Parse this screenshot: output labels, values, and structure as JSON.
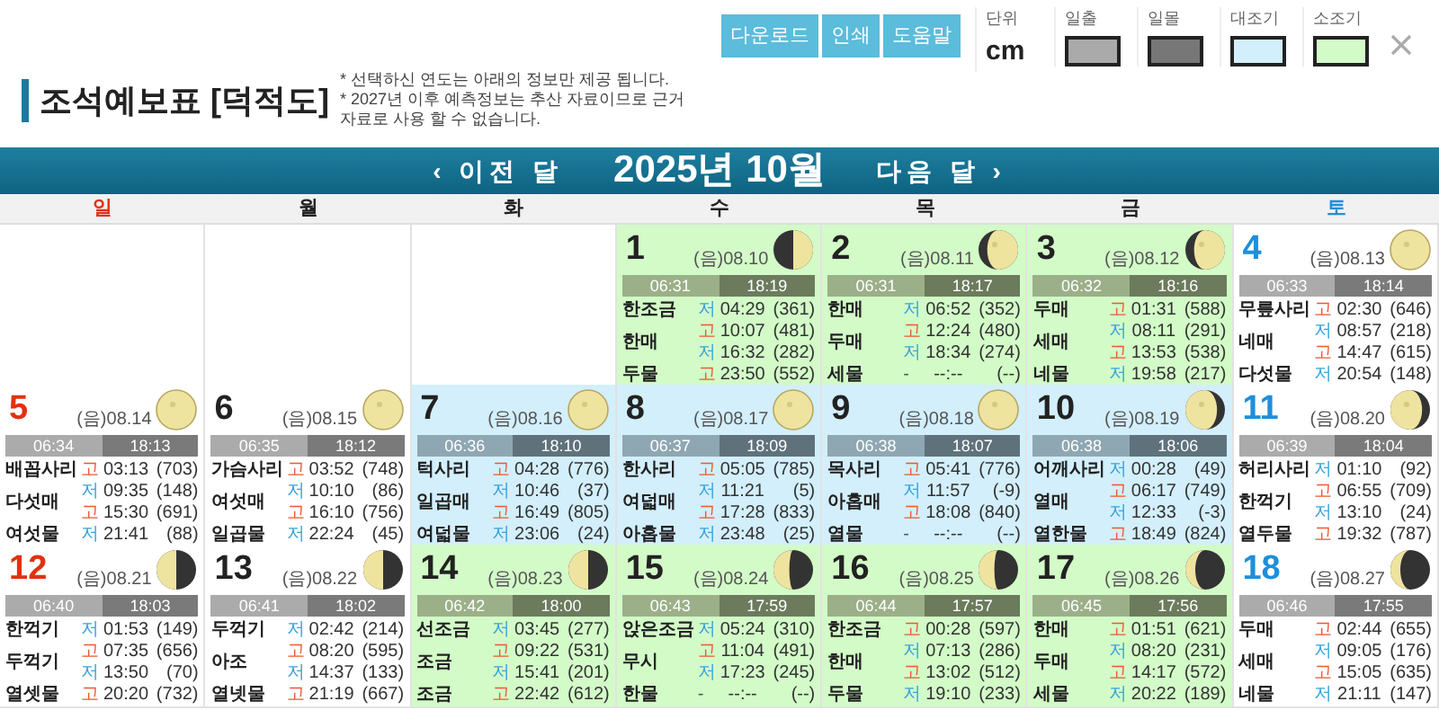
{
  "toolbar": {
    "buttons": [
      "다운로드",
      "인쇄",
      "도움말"
    ],
    "unit": {
      "label": "단위",
      "value": "cm"
    },
    "legend": [
      {
        "label": "일출",
        "color": "#aaaaaa"
      },
      {
        "label": "일몰",
        "color": "#777777"
      },
      {
        "label": "대조기",
        "color": "#d3effc"
      },
      {
        "label": "소조기",
        "color": "#d3fbc8"
      }
    ]
  },
  "title": "조석예보표 [덕적도]",
  "notes": [
    "* 선택하신 연도는 아래의 정보만 제공 됩니다.",
    "* 2027년 이후 예측정보는 추산 자료이므로 근거 자료로 사용 할 수 없습니다."
  ],
  "nav": {
    "prev": "‹ 이전 달",
    "month": "2025년 10월",
    "next": "다음 달 ›"
  },
  "weekdays": [
    {
      "label": "일",
      "kind": "sunday"
    },
    {
      "label": "월",
      "kind": "weekday"
    },
    {
      "label": "화",
      "kind": "weekday"
    },
    {
      "label": "수",
      "kind": "weekday"
    },
    {
      "label": "목",
      "kind": "weekday"
    },
    {
      "label": "금",
      "kind": "weekday"
    },
    {
      "label": "토",
      "kind": "saturday"
    }
  ],
  "weeks": [
    [
      {
        "kind": "empty"
      },
      {
        "kind": "empty"
      },
      {
        "kind": "empty"
      },
      {
        "kind": "neap",
        "day": "1",
        "lunar": "(음)08.10",
        "moon": {
          "kind": "first-quarter"
        },
        "sunrise": "06:31",
        "sunset": "18:19",
        "names": [
          "한조금",
          "한매",
          "두물"
        ],
        "tides": [
          {
            "kind": "low",
            "mark": "저",
            "time": "04:29",
            "height": "(361)"
          },
          {
            "kind": "high",
            "mark": "고",
            "time": "10:07",
            "height": "(481)"
          },
          {
            "kind": "low",
            "mark": "저",
            "time": "16:32",
            "height": "(282)"
          },
          {
            "kind": "high",
            "mark": "고",
            "time": "23:50",
            "height": "(552)"
          }
        ]
      },
      {
        "kind": "neap",
        "day": "2",
        "lunar": "(음)08.11",
        "moon": {
          "kind": "waxing-gibbous"
        },
        "sunrise": "06:31",
        "sunset": "18:17",
        "names": [
          "한매",
          "두매",
          "세물"
        ],
        "tides": [
          {
            "kind": "low",
            "mark": "저",
            "time": "06:52",
            "height": "(352)"
          },
          {
            "kind": "high",
            "mark": "고",
            "time": "12:24",
            "height": "(480)"
          },
          {
            "kind": "low",
            "mark": "저",
            "time": "18:34",
            "height": "(274)"
          },
          {
            "kind": "none",
            "mark": "-",
            "time": "--:--",
            "height": "(--)"
          }
        ]
      },
      {
        "kind": "neap",
        "day": "3",
        "lunar": "(음)08.12",
        "moon": {
          "kind": "waxing-gibbous"
        },
        "sunrise": "06:32",
        "sunset": "18:16",
        "names": [
          "두매",
          "세매",
          "네물"
        ],
        "tides": [
          {
            "kind": "high",
            "mark": "고",
            "time": "01:31",
            "height": "(588)"
          },
          {
            "kind": "low",
            "mark": "저",
            "time": "08:11",
            "height": "(291)"
          },
          {
            "kind": "high",
            "mark": "고",
            "time": "13:53",
            "height": "(538)"
          },
          {
            "kind": "low",
            "mark": "저",
            "time": "19:58",
            "height": "(217)"
          }
        ]
      },
      {
        "kind": "normal",
        "day": "4",
        "lunar": "(음)08.13",
        "moon": {
          "kind": "full"
        },
        "sunrise": "06:33",
        "sunset": "18:14",
        "names": [
          "무릎사리",
          "네매",
          "다섯물"
        ],
        "tides": [
          {
            "kind": "high",
            "mark": "고",
            "time": "02:30",
            "height": "(646)"
          },
          {
            "kind": "low",
            "mark": "저",
            "time": "08:57",
            "height": "(218)"
          },
          {
            "kind": "high",
            "mark": "고",
            "time": "14:47",
            "height": "(615)"
          },
          {
            "kind": "low",
            "mark": "저",
            "time": "20:54",
            "height": "(148)"
          }
        ]
      }
    ],
    [
      {
        "kind": "normal",
        "day": "5",
        "lunar": "(음)08.14",
        "moon": {
          "kind": "full"
        },
        "sunrise": "06:34",
        "sunset": "18:13",
        "names": [
          "배꼽사리",
          "다섯매",
          "여섯물"
        ],
        "tides": [
          {
            "kind": "high",
            "mark": "고",
            "time": "03:13",
            "height": "(703)"
          },
          {
            "kind": "low",
            "mark": "저",
            "time": "09:35",
            "height": "(148)"
          },
          {
            "kind": "high",
            "mark": "고",
            "time": "15:30",
            "height": "(691)"
          },
          {
            "kind": "low",
            "mark": "저",
            "time": "21:41",
            "height": "(88)"
          }
        ]
      },
      {
        "kind": "normal",
        "day": "6",
        "lunar": "(음)08.15",
        "moon": {
          "kind": "full"
        },
        "sunrise": "06:35",
        "sunset": "18:12",
        "names": [
          "가슴사리",
          "여섯매",
          "일곱물"
        ],
        "tides": [
          {
            "kind": "high",
            "mark": "고",
            "time": "03:52",
            "height": "(748)"
          },
          {
            "kind": "low",
            "mark": "저",
            "time": "10:10",
            "height": "(86)"
          },
          {
            "kind": "high",
            "mark": "고",
            "time": "16:10",
            "height": "(756)"
          },
          {
            "kind": "low",
            "mark": "저",
            "time": "22:24",
            "height": "(45)"
          }
        ]
      },
      {
        "kind": "spring",
        "day": "7",
        "lunar": "(음)08.16",
        "moon": {
          "kind": "full"
        },
        "sunrise": "06:36",
        "sunset": "18:10",
        "names": [
          "턱사리",
          "일곱매",
          "여덟물"
        ],
        "tides": [
          {
            "kind": "high",
            "mark": "고",
            "time": "04:28",
            "height": "(776)"
          },
          {
            "kind": "low",
            "mark": "저",
            "time": "10:46",
            "height": "(37)"
          },
          {
            "kind": "high",
            "mark": "고",
            "time": "16:49",
            "height": "(805)"
          },
          {
            "kind": "low",
            "mark": "저",
            "time": "23:06",
            "height": "(24)"
          }
        ]
      },
      {
        "kind": "spring",
        "day": "8",
        "lunar": "(음)08.17",
        "moon": {
          "kind": "full"
        },
        "sunrise": "06:37",
        "sunset": "18:09",
        "names": [
          "한사리",
          "여덟매",
          "아홉물"
        ],
        "tides": [
          {
            "kind": "high",
            "mark": "고",
            "time": "05:05",
            "height": "(785)"
          },
          {
            "kind": "low",
            "mark": "저",
            "time": "11:21",
            "height": "(5)"
          },
          {
            "kind": "high",
            "mark": "고",
            "time": "17:28",
            "height": "(833)"
          },
          {
            "kind": "low",
            "mark": "저",
            "time": "23:48",
            "height": "(25)"
          }
        ]
      },
      {
        "kind": "spring",
        "day": "9",
        "lunar": "(음)08.18",
        "moon": {
          "kind": "full"
        },
        "sunrise": "06:38",
        "sunset": "18:07",
        "names": [
          "목사리",
          "아홉매",
          "열물"
        ],
        "tides": [
          {
            "kind": "high",
            "mark": "고",
            "time": "05:41",
            "height": "(776)"
          },
          {
            "kind": "low",
            "mark": "저",
            "time": "11:57",
            "height": "(-9)"
          },
          {
            "kind": "high",
            "mark": "고",
            "time": "18:08",
            "height": "(840)"
          },
          {
            "kind": "none",
            "mark": "-",
            "time": "--:--",
            "height": "(--)"
          }
        ]
      },
      {
        "kind": "spring",
        "day": "10",
        "lunar": "(음)08.19",
        "moon": {
          "kind": "waning-gibbous"
        },
        "sunrise": "06:38",
        "sunset": "18:06",
        "names": [
          "어깨사리",
          "열매",
          "열한물"
        ],
        "tides": [
          {
            "kind": "low",
            "mark": "저",
            "time": "00:28",
            "height": "(49)"
          },
          {
            "kind": "high",
            "mark": "고",
            "time": "06:17",
            "height": "(749)"
          },
          {
            "kind": "low",
            "mark": "저",
            "time": "12:33",
            "height": "(-3)"
          },
          {
            "kind": "high",
            "mark": "고",
            "time": "18:49",
            "height": "(824)"
          }
        ]
      },
      {
        "kind": "normal",
        "day": "11",
        "lunar": "(음)08.20",
        "moon": {
          "kind": "waning-gibbous"
        },
        "sunrise": "06:39",
        "sunset": "18:04",
        "names": [
          "허리사리",
          "한꺽기",
          "열두물"
        ],
        "tides": [
          {
            "kind": "low",
            "mark": "저",
            "time": "01:10",
            "height": "(92)"
          },
          {
            "kind": "high",
            "mark": "고",
            "time": "06:55",
            "height": "(709)"
          },
          {
            "kind": "low",
            "mark": "저",
            "time": "13:10",
            "height": "(24)"
          },
          {
            "kind": "high",
            "mark": "고",
            "time": "19:32",
            "height": "(787)"
          }
        ]
      }
    ],
    [
      {
        "kind": "normal",
        "day": "12",
        "lunar": "(음)08.21",
        "moon": {
          "kind": "last-quarter"
        },
        "sunrise": "06:40",
        "sunset": "18:03",
        "names": [
          "한꺽기",
          "두꺽기",
          "열셋물"
        ],
        "tides": [
          {
            "kind": "low",
            "mark": "저",
            "time": "01:53",
            "height": "(149)"
          },
          {
            "kind": "high",
            "mark": "고",
            "time": "07:35",
            "height": "(656)"
          },
          {
            "kind": "low",
            "mark": "저",
            "time": "13:50",
            "height": "(70)"
          },
          {
            "kind": "high",
            "mark": "고",
            "time": "20:20",
            "height": "(732)"
          }
        ]
      },
      {
        "kind": "normal",
        "day": "13",
        "lunar": "(음)08.22",
        "moon": {
          "kind": "last-quarter"
        },
        "sunrise": "06:41",
        "sunset": "18:02",
        "names": [
          "두꺽기",
          "아조",
          "열넷물"
        ],
        "tides": [
          {
            "kind": "low",
            "mark": "저",
            "time": "02:42",
            "height": "(214)"
          },
          {
            "kind": "high",
            "mark": "고",
            "time": "08:20",
            "height": "(595)"
          },
          {
            "kind": "low",
            "mark": "저",
            "time": "14:37",
            "height": "(133)"
          },
          {
            "kind": "high",
            "mark": "고",
            "time": "21:19",
            "height": "(667)"
          }
        ]
      },
      {
        "kind": "neap",
        "day": "14",
        "lunar": "(음)08.23",
        "moon": {
          "kind": "last-quarter"
        },
        "sunrise": "06:42",
        "sunset": "18:00",
        "names": [
          "선조금",
          "조금",
          "조금"
        ],
        "tides": [
          {
            "kind": "low",
            "mark": "저",
            "time": "03:45",
            "height": "(277)"
          },
          {
            "kind": "high",
            "mark": "고",
            "time": "09:22",
            "height": "(531)"
          },
          {
            "kind": "low",
            "mark": "저",
            "time": "15:41",
            "height": "(201)"
          },
          {
            "kind": "high",
            "mark": "고",
            "time": "22:42",
            "height": "(612)"
          }
        ]
      },
      {
        "kind": "neap",
        "day": "15",
        "lunar": "(음)08.24",
        "moon": {
          "kind": "waning-crescent"
        },
        "sunrise": "06:43",
        "sunset": "17:59",
        "names": [
          "앉은조금",
          "무시",
          "한물"
        ],
        "tides": [
          {
            "kind": "low",
            "mark": "저",
            "time": "05:24",
            "height": "(310)"
          },
          {
            "kind": "high",
            "mark": "고",
            "time": "11:04",
            "height": "(491)"
          },
          {
            "kind": "low",
            "mark": "저",
            "time": "17:23",
            "height": "(245)"
          },
          {
            "kind": "none",
            "mark": "-",
            "time": "--:--",
            "height": "(--)"
          }
        ]
      },
      {
        "kind": "neap",
        "day": "16",
        "lunar": "(음)08.25",
        "moon": {
          "kind": "waning-crescent"
        },
        "sunrise": "06:44",
        "sunset": "17:57",
        "names": [
          "한조금",
          "한매",
          "두물"
        ],
        "tides": [
          {
            "kind": "high",
            "mark": "고",
            "time": "00:28",
            "height": "(597)"
          },
          {
            "kind": "low",
            "mark": "저",
            "time": "07:13",
            "height": "(286)"
          },
          {
            "kind": "high",
            "mark": "고",
            "time": "13:02",
            "height": "(512)"
          },
          {
            "kind": "low",
            "mark": "저",
            "time": "19:10",
            "height": "(233)"
          }
        ]
      },
      {
        "kind": "neap",
        "day": "17",
        "lunar": "(음)08.26",
        "moon": {
          "kind": "thin-crescent"
        },
        "sunrise": "06:45",
        "sunset": "17:56",
        "names": [
          "한매",
          "두매",
          "세물"
        ],
        "tides": [
          {
            "kind": "high",
            "mark": "고",
            "time": "01:51",
            "height": "(621)"
          },
          {
            "kind": "low",
            "mark": "저",
            "time": "08:20",
            "height": "(231)"
          },
          {
            "kind": "high",
            "mark": "고",
            "time": "14:17",
            "height": "(572)"
          },
          {
            "kind": "low",
            "mark": "저",
            "time": "20:22",
            "height": "(189)"
          }
        ]
      },
      {
        "kind": "normal",
        "day": "18",
        "lunar": "(음)08.27",
        "moon": {
          "kind": "thin-crescent"
        },
        "sunrise": "06:46",
        "sunset": "17:55",
        "names": [
          "두매",
          "세매",
          "네물"
        ],
        "tides": [
          {
            "kind": "high",
            "mark": "고",
            "time": "02:44",
            "height": "(655)"
          },
          {
            "kind": "low",
            "mark": "저",
            "time": "09:05",
            "height": "(176)"
          },
          {
            "kind": "high",
            "mark": "고",
            "time": "15:05",
            "height": "(635)"
          },
          {
            "kind": "low",
            "mark": "저",
            "time": "21:11",
            "height": "(147)"
          }
        ]
      }
    ]
  ]
}
